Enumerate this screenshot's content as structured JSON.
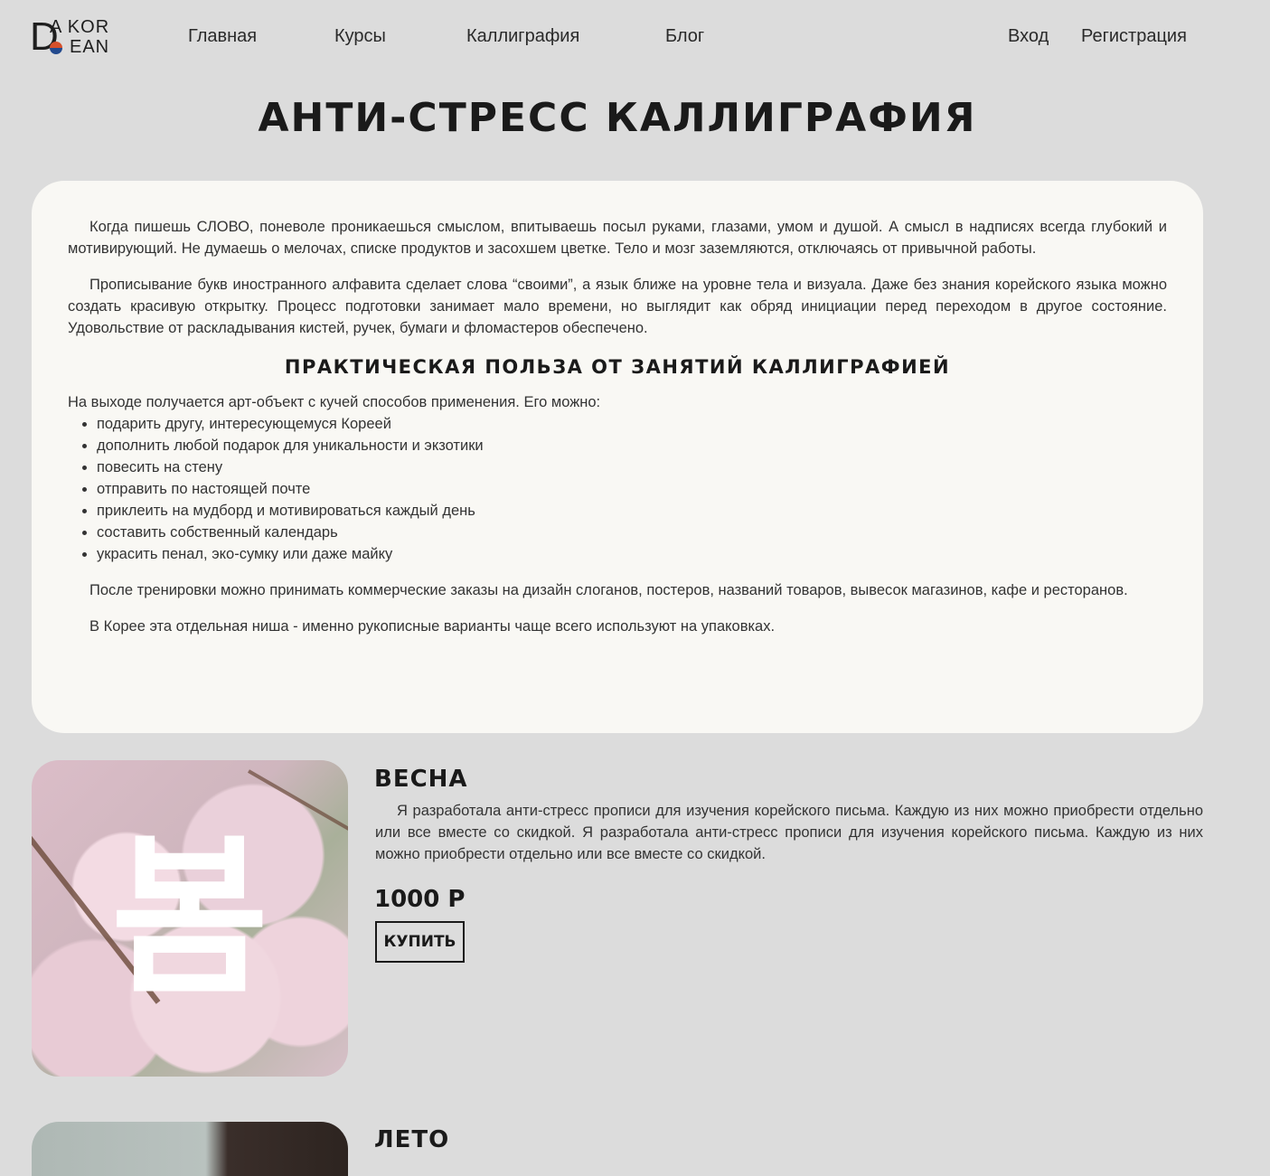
{
  "logo": {
    "letter": "D",
    "line1": "A KOR",
    "line2": "EAN"
  },
  "nav": {
    "items": [
      {
        "label": "Главная"
      },
      {
        "label": "Курсы"
      },
      {
        "label": "Каллиграфия"
      },
      {
        "label": "Блог"
      }
    ],
    "login": "Вход",
    "register": "Регистрация"
  },
  "page_title": "АНТИ-СТРЕСС КАЛЛИГРАФИЯ",
  "article": {
    "p1": "Когда пишешь СЛОВО, поневоле проникаешься смыслом, впитываешь посыл руками, глазами, умом и душой. А смысл в надписях всегда глубокий и мотивирующий. Не думаешь о мелочах, списке продуктов и засохшем цветке. Тело и мозг заземляются, отключаясь от привычной работы.",
    "p2": "Прописывание букв иностранного алфавита сделает слова “своими”, а язык ближе на уровне тела и визуала. Даже без знания корейского языка можно создать красивую открытку. Процесс подготовки занимает мало времени, но выглядит как обряд инициации перед переходом в другое состояние. Удовольствие от раскладывания кистей, ручек, бумаги и фломастеров обеспечено.",
    "heading": "ПРАКТИЧЕСКАЯ ПОЛЬЗА ОТ ЗАНЯТИЙ КАЛЛИГРАФИЕЙ",
    "intro": "На выходе получается арт-объект с кучей способов применения. Его можно:",
    "uses": [
      "подарить другу, интересующемуся Кореей",
      "дополнить любой подарок для уникальности и экзотики",
      "повесить на стену",
      "отправить по настоящей почте",
      "приклеить на мудборд и мотивироваться каждый день",
      "составить собственный календарь",
      "украсить пенал, эко-сумку или даже майку"
    ],
    "p3": "После тренировки можно принимать коммерческие заказы на дизайн слоганов, постеров, названий товаров, вывесок магазинов, кафе и ресторанов.",
    "p4": "В Корее эта отдельная ниша - именно рукописные варианты чаще всего используют на упаковках."
  },
  "products": [
    {
      "title": "ВЕСНА",
      "glyph": "봄",
      "description": "Я разработала анти-стресс прописи для изучения корейского письма. Каждую из них можно приобрести отдельно или все вместе со скидкой. Я разработала анти-стресс прописи для изучения корейского письма. Каждую из них можно приобрести отдельно или все вместе со скидкой.",
      "price": "1000 Р",
      "buy_label": "КУПИТЬ"
    },
    {
      "title": "ЛЕТО"
    }
  ],
  "colors": {
    "background": "#dcdcdc",
    "card": "#f9f8f4",
    "text": "#1e1e1e",
    "logo_red": "#d6502b",
    "logo_blue": "#234a8e"
  }
}
